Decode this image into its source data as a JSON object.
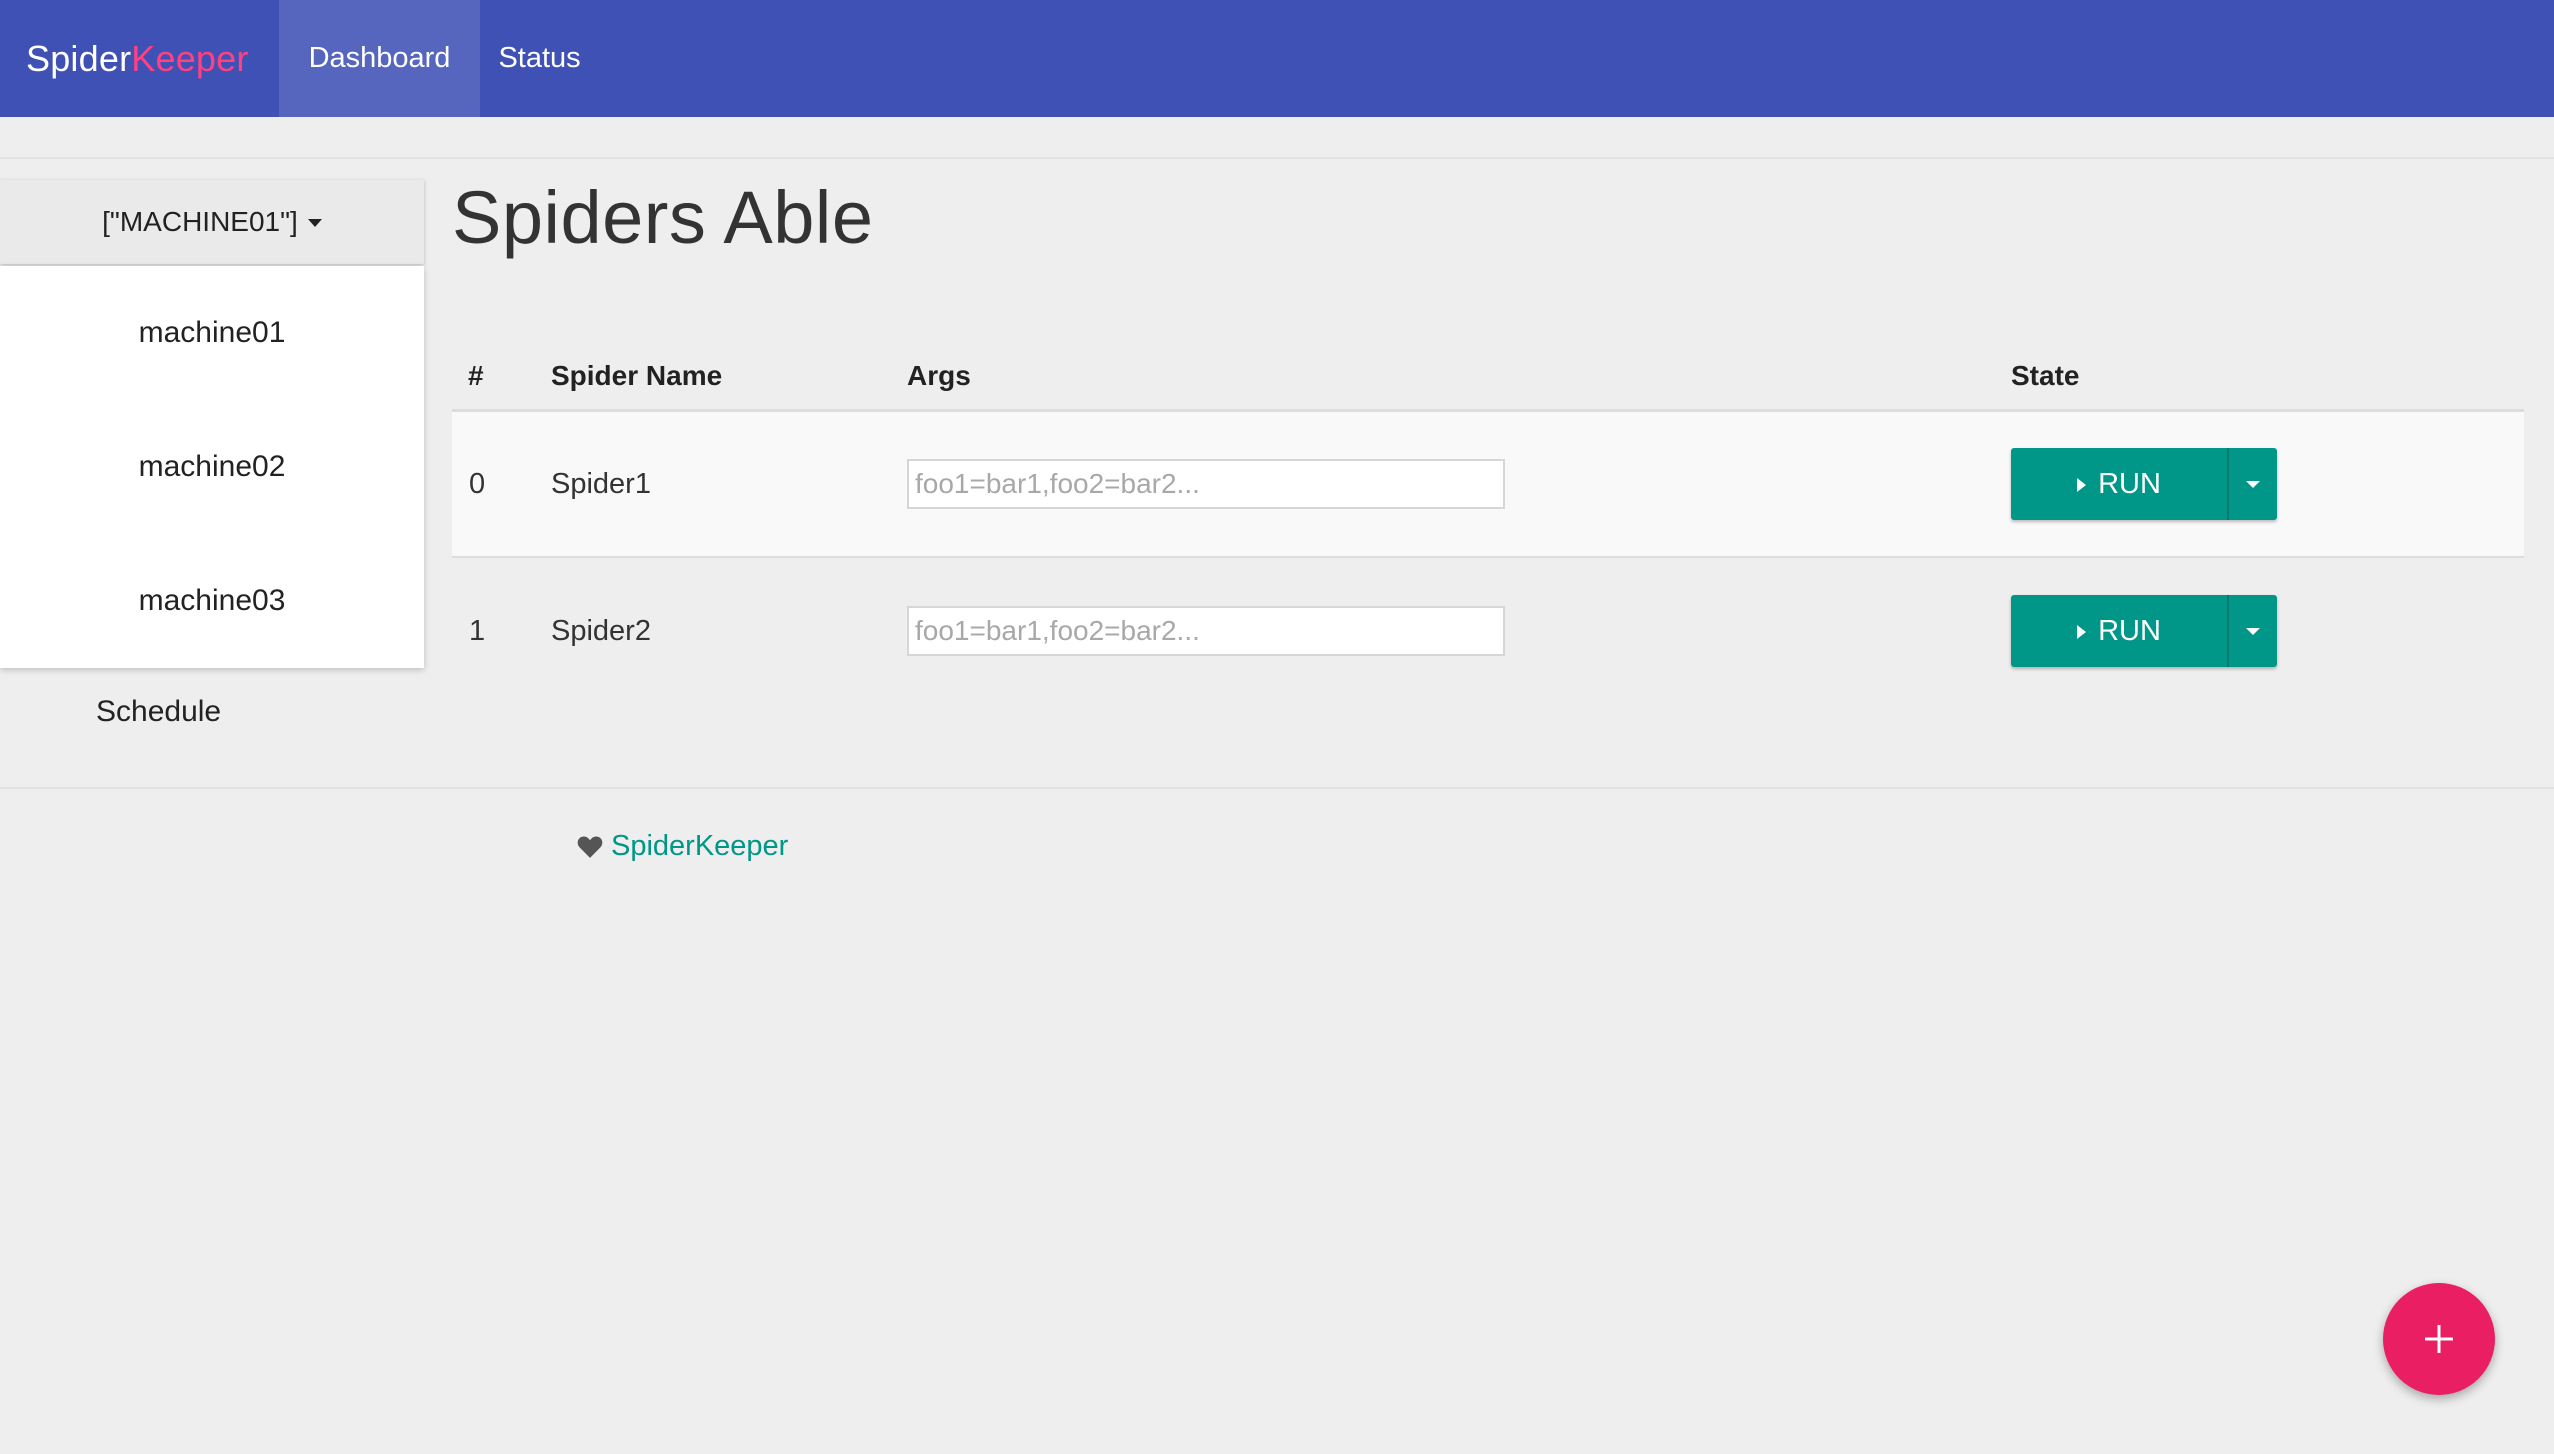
{
  "navbar": {
    "brand_part1": "Spider",
    "brand_part2": "Keeper",
    "items": [
      {
        "label": "Dashboard",
        "active": true
      },
      {
        "label": "Status",
        "active": false
      }
    ]
  },
  "sidebar": {
    "machine_selector": "[\"MACHINE01\"]",
    "machines": [
      "machine01",
      "machine02",
      "machine03"
    ],
    "schedule_label": "Schedule"
  },
  "main": {
    "title": "Spiders Able",
    "table": {
      "headers": [
        "#",
        "Spider Name",
        "Args",
        "State"
      ],
      "rows": [
        {
          "index": "0",
          "name": "Spider1",
          "args_value": "",
          "args_placeholder": "foo1=bar1,foo2=bar2...",
          "run_label": "RUN"
        },
        {
          "index": "1",
          "name": "Spider2",
          "args_value": "",
          "args_placeholder": "foo1=bar1,foo2=bar2...",
          "run_label": "RUN"
        }
      ]
    }
  },
  "footer": {
    "icon": "heart-icon",
    "link_label": "SpiderKeeper"
  },
  "fab": {
    "icon": "plus-icon"
  },
  "colors": {
    "navbar": "#3f51b5",
    "brand_accent": "#ff4081",
    "run_button": "#009688",
    "fab": "#e91e63",
    "link": "#009688"
  }
}
